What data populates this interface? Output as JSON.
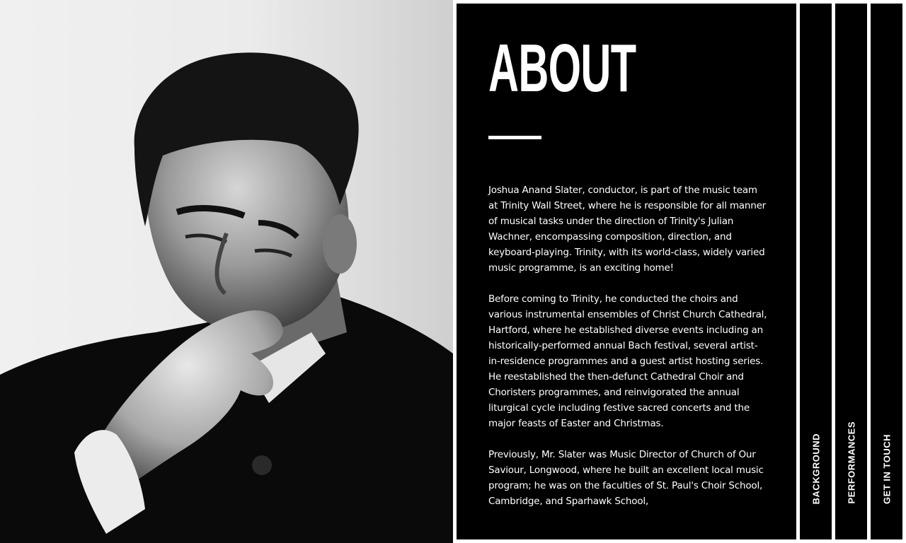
{
  "about": {
    "title": "ABOUT",
    "paragraphs": [
      "Joshua Anand Slater, conductor, is part of the music team at Trinity Wall Street, where he is responsible for all manner of musical tasks under the direction of Trinity's Julian Wachner, encompassing composition, direction, and keyboard-playing. Trinity, with its world-class, widely varied music programme, is an exciting home!",
      "Before coming to Trinity, he conducted the choirs and various instrumental ensembles of Christ Church Cathedral, Hartford, where he established diverse events including an historically-performed annual Bach festival, several artist-in-residence programmes and a guest artist hosting series. He reestablished the then-defunct Cathedral Choir and Choristers programmes, and reinvigorated the annual liturgical cycle including festive sacred concerts and the major feasts of Easter and Christmas.",
      "Previously, Mr. Slater was Music Director of Church of Our Saviour, Longwood, where he built an excellent local music program; he was on the faculties of St. Paul's Choir School, Cambridge, and Sparhawk School,"
    ]
  },
  "tabs": [
    {
      "label": "BACKGROUND"
    },
    {
      "label": "PERFORMANCES"
    },
    {
      "label": "GET IN TOUCH"
    }
  ],
  "colors": {
    "panel": "#000000",
    "text": "#ffffff",
    "page": "#ffffff"
  },
  "photo": {
    "subject": "portrait of conductor, hand to chin, black-and-white"
  }
}
